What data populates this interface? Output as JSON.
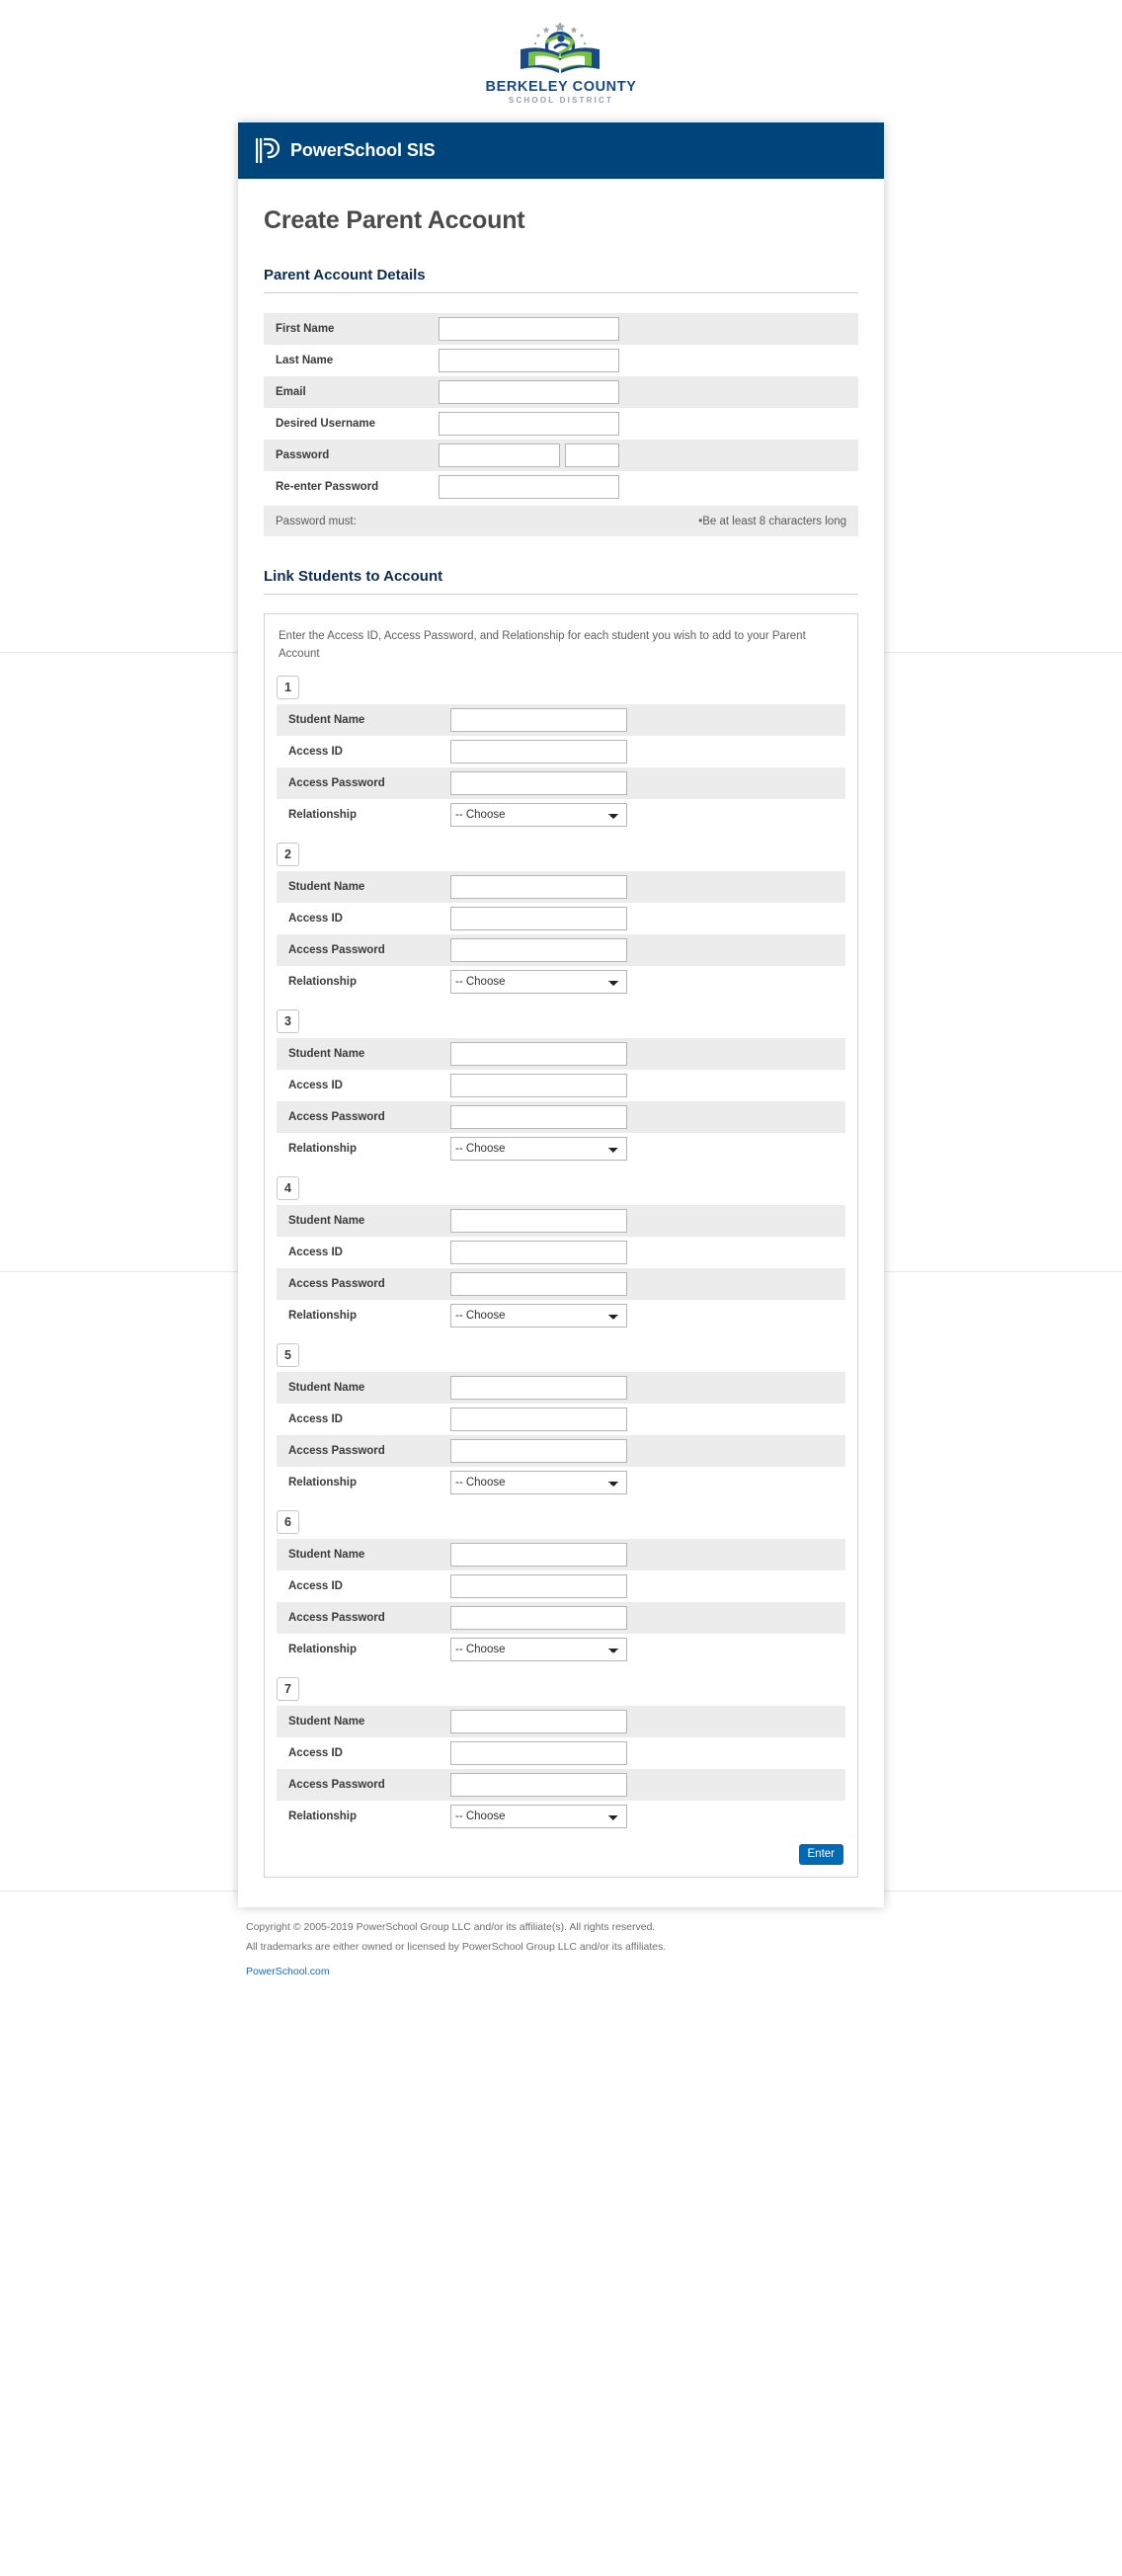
{
  "district_logo": {
    "name": "BERKELEY COUNTY",
    "subtitle": "SCHOOL DISTRICT",
    "colors": {
      "navy": "#1a4a86",
      "green": "#7ac143",
      "star": "#9aa7b4"
    }
  },
  "header": {
    "product_title": "PowerSchool SIS",
    "background": "#00447c"
  },
  "page_title": "Create Parent Account",
  "parent_account": {
    "section_title": "Parent Account Details",
    "fields": [
      {
        "label": "First Name",
        "value": "",
        "placeholder": ""
      },
      {
        "label": "Last Name",
        "value": "",
        "placeholder": ""
      },
      {
        "label": "Email",
        "value": "",
        "placeholder": ""
      },
      {
        "label": "Desired Username",
        "value": "",
        "placeholder": ""
      },
      {
        "label": "Password",
        "value": "",
        "placeholder": ""
      },
      {
        "label": "Re-enter Password",
        "value": "",
        "placeholder": ""
      }
    ],
    "password_note": {
      "left": "Password must:",
      "right": "•Be at least 8 characters long"
    }
  },
  "link_students": {
    "section_title": "Link Students to Account",
    "intro": "Enter the Access ID, Access Password, and Relationship for each student you wish to add to your Parent Account",
    "row_labels": {
      "student_name": "Student Name",
      "access_id": "Access ID",
      "access_password": "Access Password",
      "relationship": "Relationship"
    },
    "relationship_selected": "-- Choose",
    "relationship_options": [
      "-- Choose"
    ],
    "students": [
      {
        "number": "1",
        "student_name": "",
        "access_id": "",
        "access_password": "",
        "relationship": "-- Choose"
      },
      {
        "number": "2",
        "student_name": "",
        "access_id": "",
        "access_password": "",
        "relationship": "-- Choose"
      },
      {
        "number": "3",
        "student_name": "",
        "access_id": "",
        "access_password": "",
        "relationship": "-- Choose"
      },
      {
        "number": "4",
        "student_name": "",
        "access_id": "",
        "access_password": "",
        "relationship": "-- Choose"
      },
      {
        "number": "5",
        "student_name": "",
        "access_id": "",
        "access_password": "",
        "relationship": "-- Choose"
      },
      {
        "number": "6",
        "student_name": "",
        "access_id": "",
        "access_password": "",
        "relationship": "-- Choose"
      },
      {
        "number": "7",
        "student_name": "",
        "access_id": "",
        "access_password": "",
        "relationship": "-- Choose"
      }
    ]
  },
  "submit": {
    "label": "Enter",
    "color": "#0069b4"
  },
  "footer": {
    "line1": "Copyright © 2005-2019 PowerSchool Group LLC and/or its affiliate(s). All rights reserved.",
    "line2": "All trademarks are either owned or licensed by PowerSchool Group LLC and/or its affiliates.",
    "link": "PowerSchool.com"
  }
}
